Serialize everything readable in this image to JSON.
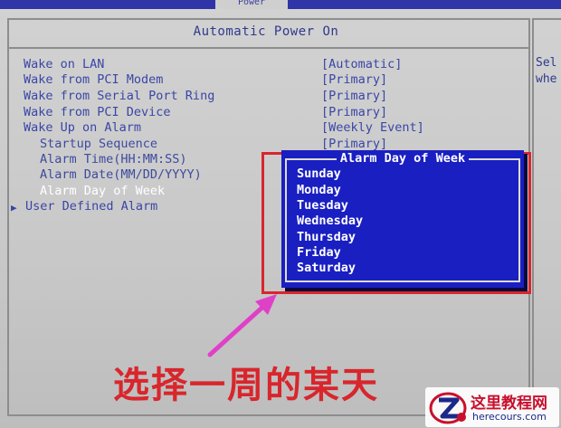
{
  "top_tab": "Power",
  "panel_title": "Automatic Power On",
  "help_lines": [
    "Sel",
    "whe"
  ],
  "items": [
    {
      "label": "Wake on LAN",
      "value": "[Automatic]"
    },
    {
      "label": "Wake from PCI Modem",
      "value": "[Primary]"
    },
    {
      "label": "Wake from Serial Port Ring",
      "value": "[Primary]"
    },
    {
      "label": "Wake from PCI Device",
      "value": "[Primary]"
    },
    {
      "label": "Wake Up on Alarm",
      "value": "[Weekly Event]"
    },
    {
      "label": "Startup Sequence",
      "value": "[Primary]"
    },
    {
      "label": "Alarm Time(HH:MM:SS)",
      "value": ""
    },
    {
      "label": "Alarm Date(MM/DD/YYYY)",
      "value": ""
    },
    {
      "label": "Alarm Day of Week",
      "value": ""
    },
    {
      "label": "User Defined Alarm",
      "value": ""
    }
  ],
  "submenu_marker": "▶",
  "popup": {
    "title": "Alarm Day of Week",
    "options": [
      "Sunday",
      "Monday",
      "Tuesday",
      "Wednesday",
      "Thursday",
      "Friday",
      "Saturday"
    ]
  },
  "caption": "选择一周的某天",
  "watermark": {
    "name": "这里教程网",
    "url": "herecours.com",
    "icon": "z-logo-icon"
  },
  "colors": {
    "bios_blue_text": "#3a46a6",
    "popup_bg": "#1a1fc2",
    "highlight_red": "#d8262c",
    "arrow_magenta": "#e040c8"
  }
}
